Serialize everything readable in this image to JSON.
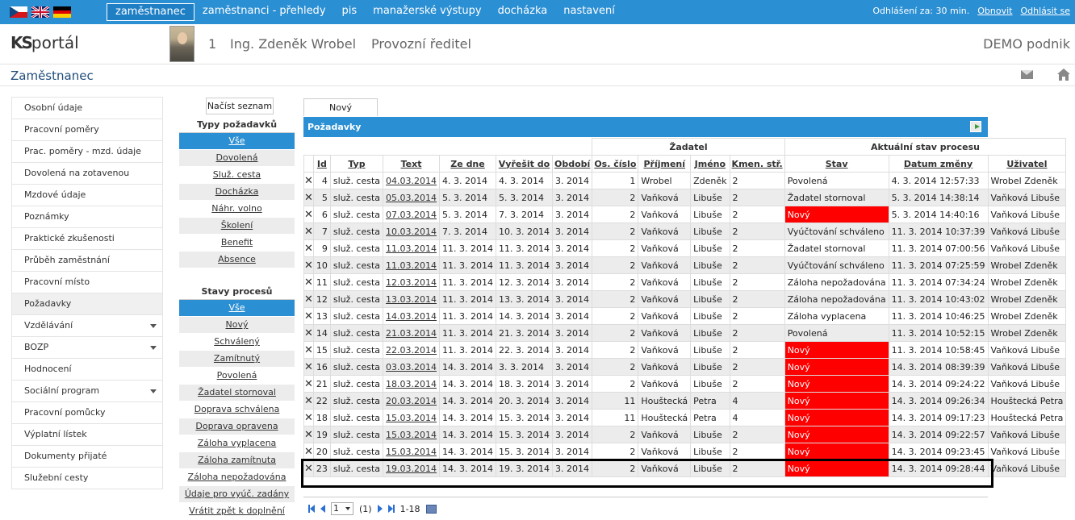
{
  "topbar": {
    "nav": [
      "zaměstnanec",
      "zaměstnanci - přehledy",
      "pis",
      "manažerské výstupy",
      "docházka",
      "nastavení"
    ],
    "logout_timer": "Odhlášení za: 30 min.",
    "renew": "Obnovit",
    "logout": "Odhlásit se",
    "accent": "#2b8fd3"
  },
  "header": {
    "logo": "portál",
    "logo_prefix": "KS",
    "employee_id": "1",
    "employee_name": "Ing. Zdeněk Wrobel",
    "position": "Provozní ředitel",
    "company": "DEMO podnik"
  },
  "page": {
    "title": "Zaměstnanec"
  },
  "leftmenu": [
    {
      "label": "Osobní údaje"
    },
    {
      "label": "Pracovní poměry"
    },
    {
      "label": "Prac. poměry - mzd. údaje"
    },
    {
      "label": "Dovolená na zotavenou"
    },
    {
      "label": "Mzdové údaje"
    },
    {
      "label": "Poznámky"
    },
    {
      "label": "Praktické zkušenosti"
    },
    {
      "label": "Průběh zaměstnání"
    },
    {
      "label": "Pracovní místo"
    },
    {
      "label": "Požadavky"
    },
    {
      "label": "Vzdělávání"
    },
    {
      "label": "BOZP"
    },
    {
      "label": "Hodnocení"
    },
    {
      "label": "Sociální program"
    },
    {
      "label": "Pracovní pomůcky"
    },
    {
      "label": "Výplatní lístek"
    },
    {
      "label": "Dokumenty přijaté"
    },
    {
      "label": "Služební cesty"
    }
  ],
  "filters": {
    "load_button": "Načíst seznam",
    "types_header": "Typy požadavků",
    "types": [
      "Vše",
      "Dovolená",
      "Služ. cesta",
      "Docházka",
      "Náhr. volno",
      "Školení",
      "Benefit",
      "Absence"
    ],
    "states_header": "Stavy procesů",
    "states": [
      "Vše",
      "Nový",
      "Schválený",
      "Zamítnutý",
      "Povolená",
      "Žadatel stornoval",
      "Doprava schválena",
      "Doprava opravena",
      "Záloha vyplacena",
      "Záloha zamítnuta",
      "Záloha nepožadována",
      "Údaje pro vyúč. zadány",
      "Vrátit zpět k doplnění"
    ]
  },
  "grid": {
    "tab": "Nový požadavek",
    "title": "Požadavky",
    "group_applicant": "Žadatel",
    "group_state": "Aktuální stav procesu",
    "columns": [
      "Id",
      "Typ",
      "Text",
      "Ze dne",
      "Vyřešit do",
      "Období",
      "Os. číslo",
      "Příjmení",
      "Jméno",
      "Kmen. stř.",
      "Stav",
      "Datum změny",
      "Uživatel"
    ],
    "rows": [
      {
        "id": "4",
        "typ": "služ. cesta",
        "text": "04.03.2014",
        "ze": "4. 3. 2014",
        "do": "4. 3. 2014",
        "obd": "3. 2014",
        "os": "1",
        "prij": "Wrobel",
        "jm": "Zdeněk",
        "km": "2",
        "stav": "Povolená",
        "red": false,
        "dat": "4. 3. 2014 12:57:33",
        "uz": "Wrobel Zdeněk"
      },
      {
        "id": "5",
        "typ": "služ. cesta",
        "text": "05.03.2014",
        "ze": "5. 3. 2014",
        "do": "5. 3. 2014",
        "obd": "3. 2014",
        "os": "2",
        "prij": "Vaňková",
        "jm": "Libuše",
        "km": "2",
        "stav": "Žadatel stornoval",
        "red": false,
        "dat": "5. 3. 2014 14:38:14",
        "uz": "Vaňková Libuše"
      },
      {
        "id": "6",
        "typ": "služ. cesta",
        "text": "07.03.2014",
        "ze": "5. 3. 2014",
        "do": "7. 3. 2014",
        "obd": "3. 2014",
        "os": "2",
        "prij": "Vaňková",
        "jm": "Libuše",
        "km": "2",
        "stav": "Nový",
        "red": true,
        "dat": "5. 3. 2014 14:40:16",
        "uz": "Vaňková Libuše"
      },
      {
        "id": "7",
        "typ": "služ. cesta",
        "text": "10.03.2014",
        "ze": "7. 3. 2014",
        "do": "10. 3. 2014",
        "obd": "3. 2014",
        "os": "2",
        "prij": "Vaňková",
        "jm": "Libuše",
        "km": "2",
        "stav": "Vyúčtování schváleno",
        "red": false,
        "dat": "11. 3. 2014 10:37:39",
        "uz": "Vaňková Libuše"
      },
      {
        "id": "9",
        "typ": "služ. cesta",
        "text": "11.03.2014",
        "ze": "11. 3. 2014",
        "do": "11. 3. 2014",
        "obd": "3. 2014",
        "os": "2",
        "prij": "Vaňková",
        "jm": "Libuše",
        "km": "2",
        "stav": "Žadatel stornoval",
        "red": false,
        "dat": "11. 3. 2014 07:00:56",
        "uz": "Vaňková Libuše"
      },
      {
        "id": "10",
        "typ": "služ. cesta",
        "text": "11.03.2014",
        "ze": "11. 3. 2014",
        "do": "11. 3. 2014",
        "obd": "3. 2014",
        "os": "2",
        "prij": "Vaňková",
        "jm": "Libuše",
        "km": "2",
        "stav": "Vyúčtování schváleno",
        "red": false,
        "dat": "11. 3. 2014 07:25:59",
        "uz": "Wrobel Zdeněk"
      },
      {
        "id": "11",
        "typ": "služ. cesta",
        "text": "12.03.2014",
        "ze": "11. 3. 2014",
        "do": "12. 3. 2014",
        "obd": "3. 2014",
        "os": "2",
        "prij": "Vaňková",
        "jm": "Libuše",
        "km": "2",
        "stav": "Záloha nepožadována",
        "red": false,
        "dat": "11. 3. 2014 07:34:24",
        "uz": "Wrobel Zdeněk"
      },
      {
        "id": "12",
        "typ": "služ. cesta",
        "text": "13.03.2014",
        "ze": "11. 3. 2014",
        "do": "13. 3. 2014",
        "obd": "3. 2014",
        "os": "2",
        "prij": "Vaňková",
        "jm": "Libuše",
        "km": "2",
        "stav": "Záloha nepožadována",
        "red": false,
        "dat": "11. 3. 2014 10:43:02",
        "uz": "Wrobel Zdeněk"
      },
      {
        "id": "13",
        "typ": "služ. cesta",
        "text": "14.03.2014",
        "ze": "11. 3. 2014",
        "do": "14. 3. 2014",
        "obd": "3. 2014",
        "os": "2",
        "prij": "Vaňková",
        "jm": "Libuše",
        "km": "2",
        "stav": "Záloha vyplacena",
        "red": false,
        "dat": "11. 3. 2014 10:46:25",
        "uz": "Wrobel Zdeněk"
      },
      {
        "id": "14",
        "typ": "služ. cesta",
        "text": "21.03.2014",
        "ze": "11. 3. 2014",
        "do": "21. 3. 2014",
        "obd": "3. 2014",
        "os": "2",
        "prij": "Vaňková",
        "jm": "Libuše",
        "km": "2",
        "stav": "Povolená",
        "red": false,
        "dat": "11. 3. 2014 10:52:15",
        "uz": "Wrobel Zdeněk"
      },
      {
        "id": "15",
        "typ": "služ. cesta",
        "text": "22.03.2014",
        "ze": "11. 3. 2014",
        "do": "22. 3. 2014",
        "obd": "3. 2014",
        "os": "2",
        "prij": "Vaňková",
        "jm": "Libuše",
        "km": "2",
        "stav": "Nový",
        "red": true,
        "dat": "11. 3. 2014 10:58:45",
        "uz": "Vaňková Libuše"
      },
      {
        "id": "16",
        "typ": "služ. cesta",
        "text": "03.03.2014",
        "ze": "14. 3. 2014",
        "do": "3. 3. 2014",
        "obd": "3. 2014",
        "os": "2",
        "prij": "Vaňková",
        "jm": "Libuše",
        "km": "2",
        "stav": "Nový",
        "red": true,
        "dat": "14. 3. 2014 08:39:39",
        "uz": "Vaňková Libuše"
      },
      {
        "id": "21",
        "typ": "služ. cesta",
        "text": "18.03.2014",
        "ze": "14. 3. 2014",
        "do": "18. 3. 2014",
        "obd": "3. 2014",
        "os": "2",
        "prij": "Vaňková",
        "jm": "Libuše",
        "km": "2",
        "stav": "Nový",
        "red": true,
        "dat": "14. 3. 2014 09:24:22",
        "uz": "Vaňková Libuše"
      },
      {
        "id": "22",
        "typ": "služ. cesta",
        "text": "20.03.2014",
        "ze": "14. 3. 2014",
        "do": "20. 3. 2014",
        "obd": "3. 2014",
        "os": "11",
        "prij": "Houštecká",
        "jm": "Petra",
        "km": "4",
        "stav": "Nový",
        "red": true,
        "dat": "14. 3. 2014 09:26:34",
        "uz": "Houštecká Petra"
      },
      {
        "id": "18",
        "typ": "služ. cesta",
        "text": "15.03.2014",
        "ze": "14. 3. 2014",
        "do": "15. 3. 2014",
        "obd": "3. 2014",
        "os": "11",
        "prij": "Houštecká",
        "jm": "Petra",
        "km": "4",
        "stav": "Nový",
        "red": true,
        "dat": "14. 3. 2014 09:17:23",
        "uz": "Houštecká Petra"
      },
      {
        "id": "19",
        "typ": "služ. cesta",
        "text": "15.03.2014",
        "ze": "14. 3. 2014",
        "do": "15. 3. 2014",
        "obd": "3. 2014",
        "os": "2",
        "prij": "Vaňková",
        "jm": "Libuše",
        "km": "2",
        "stav": "Nový",
        "red": true,
        "dat": "14. 3. 2014 09:22:57",
        "uz": "Vaňková Libuše"
      },
      {
        "id": "20",
        "typ": "služ. cesta",
        "text": "15.03.2014",
        "ze": "14. 3. 2014",
        "do": "15. 3. 2014",
        "obd": "3. 2014",
        "os": "2",
        "prij": "Vaňková",
        "jm": "Libuše",
        "km": "2",
        "stav": "Nový",
        "red": true,
        "dat": "14. 3. 2014 09:23:45",
        "uz": "Vaňková Libuše"
      },
      {
        "id": "23",
        "typ": "služ. cesta",
        "text": "19.03.2014",
        "ze": "14. 3. 2014",
        "do": "19. 3. 2014",
        "obd": "3. 2014",
        "os": "2",
        "prij": "Vaňková",
        "jm": "Libuše",
        "km": "2",
        "stav": "Nový",
        "red": true,
        "dat": "14. 3. 2014 09:28:44",
        "uz": "Vaňková Libuše"
      }
    ]
  },
  "pager": {
    "page": "1",
    "pages": "(1)",
    "range": "1-18"
  }
}
